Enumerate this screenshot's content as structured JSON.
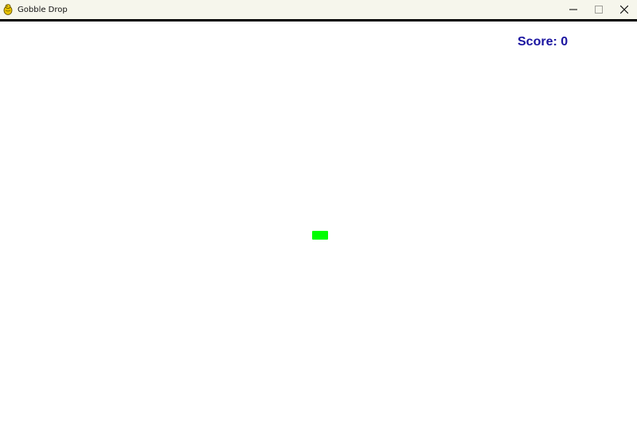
{
  "window": {
    "title": "Gobble Drop",
    "app_icon": "pygame-snake-icon",
    "controls": {
      "minimize_icon": "minimize-icon",
      "maximize_icon": "maximize-icon",
      "close_icon": "close-icon"
    }
  },
  "game": {
    "score_label": "Score: 0",
    "score_color": "#1a14a0",
    "player_color": "#00ff00",
    "background_color": "#ffffff"
  }
}
